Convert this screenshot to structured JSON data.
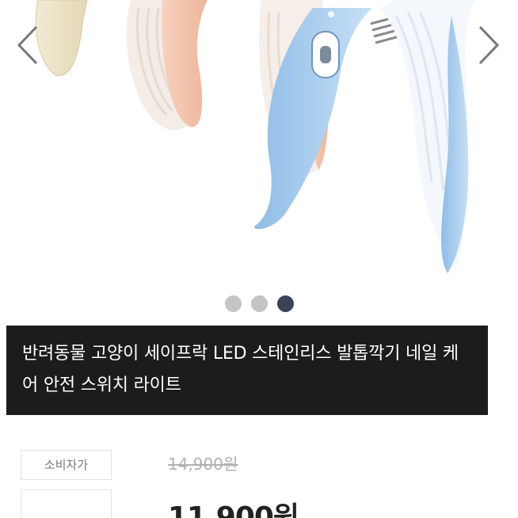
{
  "product": {
    "title": "반려동물 고양이 세이프락 LED 스테인리스 발톱깍기 네일 케어 안전 스위치 라이트",
    "list_price_label": "소비자가",
    "list_price": "14,900원",
    "sale_price": "11,900원"
  },
  "carousel": {
    "image_alt": "pastel nail clippers in cream, pink and blue",
    "slides": [
      "1",
      "2",
      "3"
    ],
    "active_slide": 3,
    "colors": {
      "cream": "#efe7cf",
      "pink": "#f2c4ab",
      "blue": "#a9cdee",
      "active_dot": "#3a4458",
      "inactive_dot": "#c4c4c4"
    }
  },
  "icons": {
    "prev": "chevron-left-icon",
    "next": "chevron-right-icon"
  }
}
